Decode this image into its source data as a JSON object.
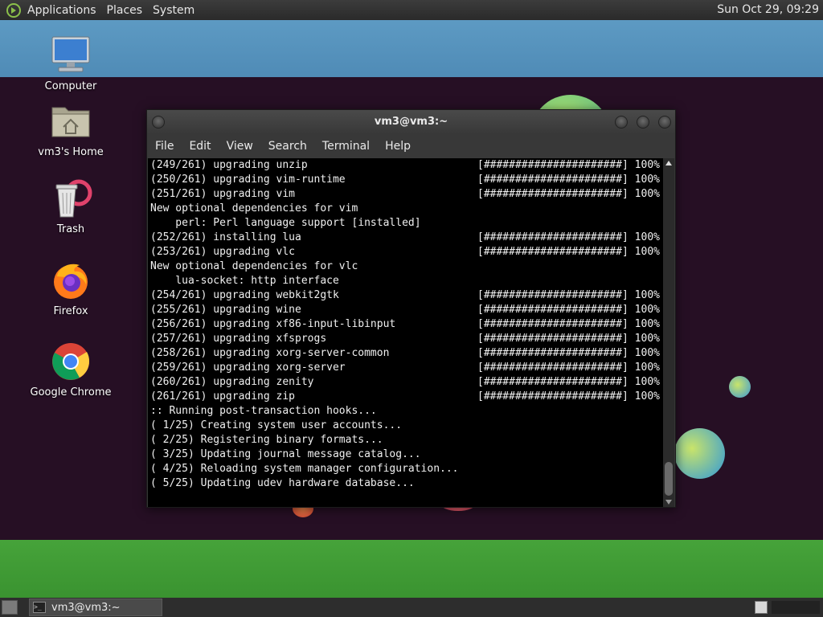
{
  "top_panel": {
    "menus": [
      "Applications",
      "Places",
      "System"
    ],
    "clock": "Sun Oct 29, 09:29"
  },
  "desktop_icons": [
    {
      "label": "Computer",
      "icon": "computer-icon"
    },
    {
      "label": "vm3's Home",
      "icon": "home-folder-icon"
    },
    {
      "label": "Trash",
      "icon": "trash-icon"
    },
    {
      "label": "Firefox",
      "icon": "firefox-icon"
    },
    {
      "label": "Google Chrome",
      "icon": "chrome-icon"
    }
  ],
  "terminal": {
    "title": "vm3@vm3:~",
    "menu": [
      "File",
      "Edit",
      "View",
      "Search",
      "Terminal",
      "Help"
    ],
    "lines": [
      {
        "text": "(249/261) upgrading unzip",
        "bar": "[######################] 100%"
      },
      {
        "text": "(250/261) upgrading vim-runtime",
        "bar": "[######################] 100%"
      },
      {
        "text": "(251/261) upgrading vim",
        "bar": "[######################] 100%"
      },
      {
        "text": "New optional dependencies for vim",
        "bar": ""
      },
      {
        "text": "    perl: Perl language support [installed]",
        "bar": ""
      },
      {
        "text": "(252/261) installing lua",
        "bar": "[######################] 100%"
      },
      {
        "text": "(253/261) upgrading vlc",
        "bar": "[######################] 100%"
      },
      {
        "text": "New optional dependencies for vlc",
        "bar": ""
      },
      {
        "text": "    lua-socket: http interface",
        "bar": ""
      },
      {
        "text": "(254/261) upgrading webkit2gtk",
        "bar": "[######################] 100%"
      },
      {
        "text": "(255/261) upgrading wine",
        "bar": "[######################] 100%"
      },
      {
        "text": "(256/261) upgrading xf86-input-libinput",
        "bar": "[######################] 100%"
      },
      {
        "text": "(257/261) upgrading xfsprogs",
        "bar": "[######################] 100%"
      },
      {
        "text": "(258/261) upgrading xorg-server-common",
        "bar": "[######################] 100%"
      },
      {
        "text": "(259/261) upgrading xorg-server",
        "bar": "[######################] 100%"
      },
      {
        "text": "(260/261) upgrading zenity",
        "bar": "[######################] 100%"
      },
      {
        "text": "(261/261) upgrading zip",
        "bar": "[######################] 100%"
      },
      {
        "text": ":: Running post-transaction hooks...",
        "bar": ""
      },
      {
        "text": "( 1/25) Creating system user accounts...",
        "bar": ""
      },
      {
        "text": "( 2/25) Registering binary formats...",
        "bar": ""
      },
      {
        "text": "( 3/25) Updating journal message catalog...",
        "bar": ""
      },
      {
        "text": "( 4/25) Reloading system manager configuration...",
        "bar": ""
      },
      {
        "text": "( 5/25) Updating udev hardware database...",
        "bar": ""
      }
    ]
  },
  "taskbar": {
    "window_button": "vm3@vm3:~"
  },
  "colors": {
    "panel": "#2d2d2d",
    "terminal_bg": "#000000",
    "desktop_dark": "#260f24",
    "desktop_sky": "#5d9ac3",
    "desktop_green": "#46a33a"
  }
}
